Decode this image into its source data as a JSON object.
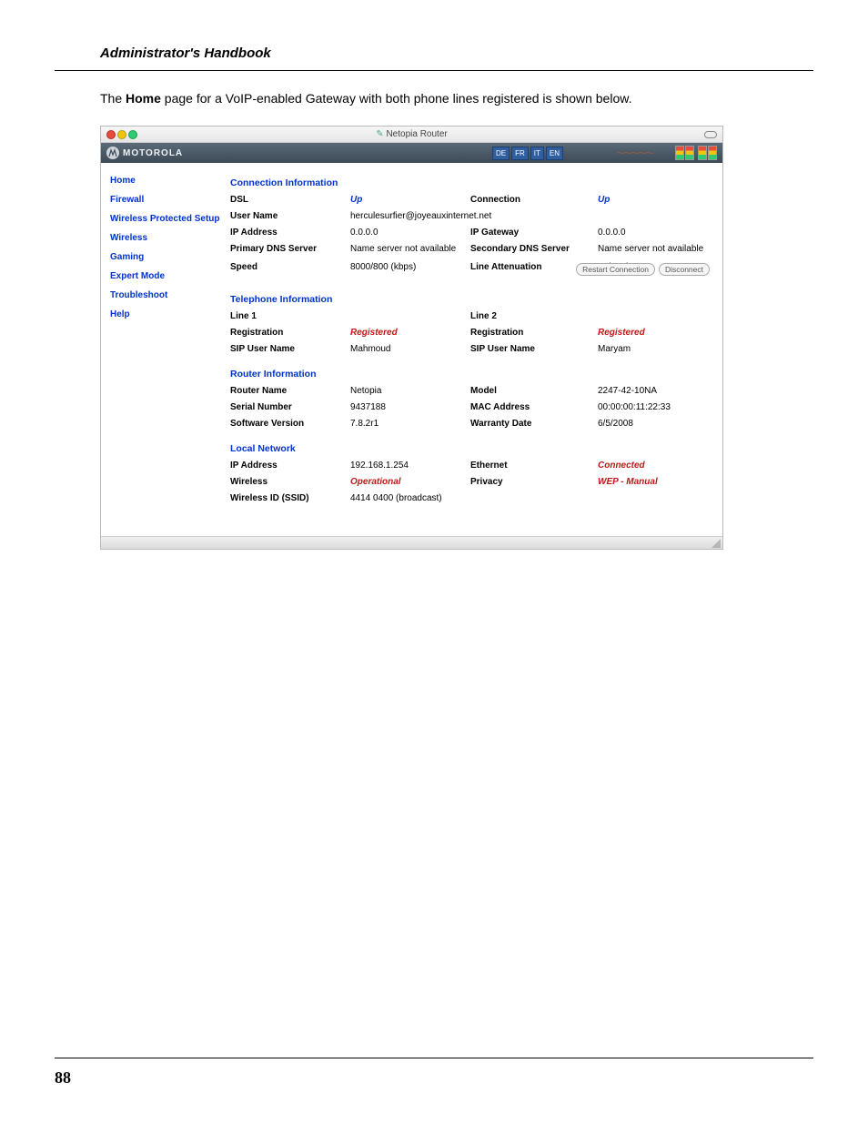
{
  "doc": {
    "header": "Administrator's Handbook",
    "intro_pre": "The ",
    "intro_bold": "Home",
    "intro_post": " page for a VoIP-enabled Gateway with both phone lines registered is shown below.",
    "page_number": "88"
  },
  "window": {
    "title": "Netopia Router",
    "brand": "MOTOROLA",
    "languages": [
      "DE",
      "FR",
      "IT",
      "EN"
    ]
  },
  "sidebar": {
    "items": [
      "Home",
      "Firewall",
      "Wireless Protected Setup",
      "Wireless",
      "Gaming",
      "Expert Mode",
      "Troubleshoot",
      "Help"
    ]
  },
  "sections": {
    "connection": {
      "title": "Connection Information",
      "dsl_label": "DSL",
      "dsl_value": "Up",
      "conn_label": "Connection",
      "conn_value": "Up",
      "user_label": "User Name",
      "user_value": "herculesurfier@joyeauxinternet.net",
      "ip_label": "IP Address",
      "ip_value": "0.0.0.0",
      "gw_label": "IP Gateway",
      "gw_value": "0.0.0.0",
      "pdns_label": "Primary DNS Server",
      "pdns_value": "Name server not available",
      "sdns_label": "Secondary DNS Server",
      "sdns_value": "Name server not available",
      "speed_label": "Speed",
      "speed_value": "8000/800 (kbps)",
      "att_label": "Line Attenuation",
      "att_value": "40/50 dB",
      "btn_restart": "Restart Connection",
      "btn_disconnect": "Disconnect"
    },
    "telephone": {
      "title": "Telephone Information",
      "line1_label": "Line 1",
      "line2_label": "Line 2",
      "reg_label": "Registration",
      "reg1_value": "Registered",
      "reg2_value": "Registered",
      "sip_label": "SIP User Name",
      "sip1_value": "Mahmoud",
      "sip2_value": "Maryam"
    },
    "router": {
      "title": "Router Information",
      "name_label": "Router Name",
      "name_value": "Netopia",
      "model_label": "Model",
      "model_value": "2247-42-10NA",
      "serial_label": "Serial Number",
      "serial_value": "9437188",
      "mac_label": "MAC Address",
      "mac_value": "00:00:00:11:22:33",
      "soft_label": "Software Version",
      "soft_value": "7.8.2r1",
      "warr_label": "Warranty Date",
      "warr_value": "6/5/2008"
    },
    "local": {
      "title": "Local Network",
      "ip_label": "IP Address",
      "ip_value": "192.168.1.254",
      "eth_label": "Ethernet",
      "eth_value": "Connected",
      "wl_label": "Wireless",
      "wl_value": "Operational",
      "priv_label": "Privacy",
      "priv_value": "WEP - Manual",
      "ssid_label": "Wireless ID (SSID)",
      "ssid_value": "4414 0400 (broadcast)"
    }
  }
}
